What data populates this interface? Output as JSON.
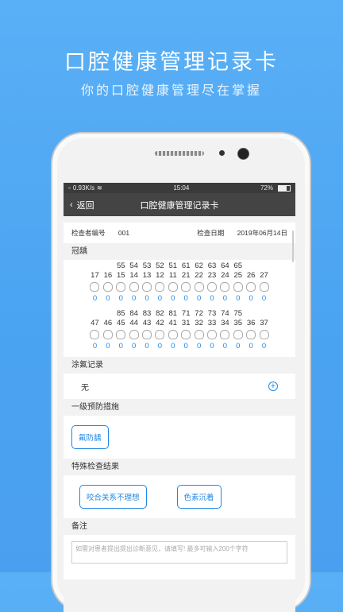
{
  "promo": {
    "title": "口腔健康管理记录卡",
    "subtitle": "你的口腔健康管理尽在掌握"
  },
  "statusbar": {
    "speed": "0.93K/s",
    "time": "15:04",
    "battery": "72%"
  },
  "nav": {
    "back": "返回",
    "title": "口腔健康管理记录卡"
  },
  "info": {
    "inspector_label": "检查者编号",
    "inspector_value": "001",
    "date_label": "检查日期",
    "date_value": "2019年06月14日"
  },
  "sections": {
    "crown": "冠龋",
    "fluoride": "涂氟记录",
    "prevention": "一级预防措施",
    "special": "特殊检查结果",
    "notes": "备注"
  },
  "teeth": {
    "upper_deciduous": [
      "55",
      "54",
      "53",
      "52",
      "51",
      "61",
      "62",
      "63",
      "64",
      "65"
    ],
    "upper_permanent": [
      "17",
      "16",
      "15",
      "14",
      "13",
      "12",
      "11",
      "21",
      "22",
      "23",
      "24",
      "25",
      "26",
      "27"
    ],
    "upper_values": [
      "0",
      "0",
      "0",
      "0",
      "0",
      "0",
      "0",
      "0",
      "0",
      "0",
      "0",
      "0",
      "0",
      "0"
    ],
    "lower_deciduous": [
      "85",
      "84",
      "83",
      "82",
      "81",
      "71",
      "72",
      "73",
      "74",
      "75"
    ],
    "lower_permanent": [
      "47",
      "46",
      "45",
      "44",
      "43",
      "42",
      "41",
      "31",
      "32",
      "33",
      "34",
      "35",
      "36",
      "37"
    ],
    "lower_values": [
      "0",
      "0",
      "0",
      "0",
      "0",
      "0",
      "0",
      "0",
      "0",
      "0",
      "0",
      "0",
      "0",
      "0"
    ]
  },
  "fluoride": {
    "value": "无",
    "add": "+"
  },
  "prevention_tags": [
    "氟防龋"
  ],
  "special_tags": [
    "咬合关系不理想",
    "色素沉着"
  ],
  "notes": {
    "placeholder": "如需对患者提出提出诊断意见，请填写! 最多可输入200个字符"
  },
  "colors": {
    "accent": "#1e88e5",
    "navbar": "#444444",
    "background": "#4aa3f1"
  }
}
